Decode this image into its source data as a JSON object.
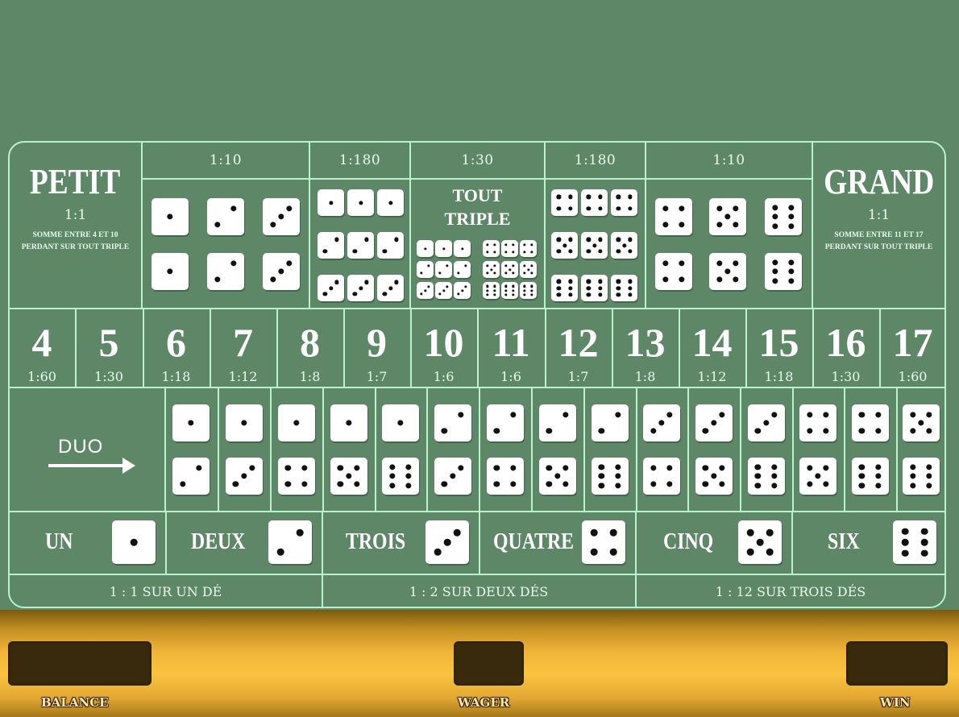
{
  "petit": {
    "title": "PETIT",
    "odds": "1:1",
    "desc1": "SOMME ENTRE 4 ET 10",
    "desc2": "PERDANT SUR TOUT TRIPLE"
  },
  "grand": {
    "title": "GRAND",
    "odds": "1:1",
    "desc1": "SOMME ENTRE 11 ET 17",
    "desc2": "PERDANT SUR TOUT TRIPLE"
  },
  "top_odds": {
    "doubles_low": "1:10",
    "triples_low": "1:180",
    "tout": "1:30",
    "triples_high": "1:180",
    "doubles_high": "1:10"
  },
  "tout_triple": {
    "line1": "TOUT",
    "line2": "TRIPLE"
  },
  "sums": [
    {
      "n": "4",
      "odds": "1:60"
    },
    {
      "n": "5",
      "odds": "1:30"
    },
    {
      "n": "6",
      "odds": "1:18"
    },
    {
      "n": "7",
      "odds": "1:12"
    },
    {
      "n": "8",
      "odds": "1:8"
    },
    {
      "n": "9",
      "odds": "1:7"
    },
    {
      "n": "10",
      "odds": "1:6"
    },
    {
      "n": "11",
      "odds": "1:6"
    },
    {
      "n": "12",
      "odds": "1:7"
    },
    {
      "n": "13",
      "odds": "1:8"
    },
    {
      "n": "14",
      "odds": "1:12"
    },
    {
      "n": "15",
      "odds": "1:18"
    },
    {
      "n": "16",
      "odds": "1:30"
    },
    {
      "n": "17",
      "odds": "1:60"
    }
  ],
  "duo": {
    "label": "DUO",
    "pairs": [
      [
        1,
        2
      ],
      [
        1,
        3
      ],
      [
        1,
        4
      ],
      [
        1,
        5
      ],
      [
        1,
        6
      ],
      [
        2,
        3
      ],
      [
        2,
        4
      ],
      [
        2,
        5
      ],
      [
        2,
        6
      ],
      [
        3,
        4
      ],
      [
        3,
        5
      ],
      [
        3,
        6
      ],
      [
        4,
        5
      ],
      [
        4,
        6
      ],
      [
        5,
        6
      ]
    ]
  },
  "singles": [
    {
      "label": "UN",
      "face": 1
    },
    {
      "label": "DEUX",
      "face": 2
    },
    {
      "label": "TROIS",
      "face": 3
    },
    {
      "label": "QUATRE",
      "face": 4
    },
    {
      "label": "CINQ",
      "face": 5
    },
    {
      "label": "SIX",
      "face": 6
    }
  ],
  "single_odds": [
    "1 : 1 SUR UN DÉ",
    "1 : 2 SUR DEUX DÉS",
    "1 : 12 SUR TROIS DÉS"
  ],
  "bar": {
    "balance_label": "BALANCE",
    "wager_label": "WAGER",
    "win_label": "WIN"
  },
  "colors": {
    "felt": "#5d8766",
    "line": "#b9f2cf",
    "gold": "#f9c43f",
    "box": "#3a2a0d"
  }
}
